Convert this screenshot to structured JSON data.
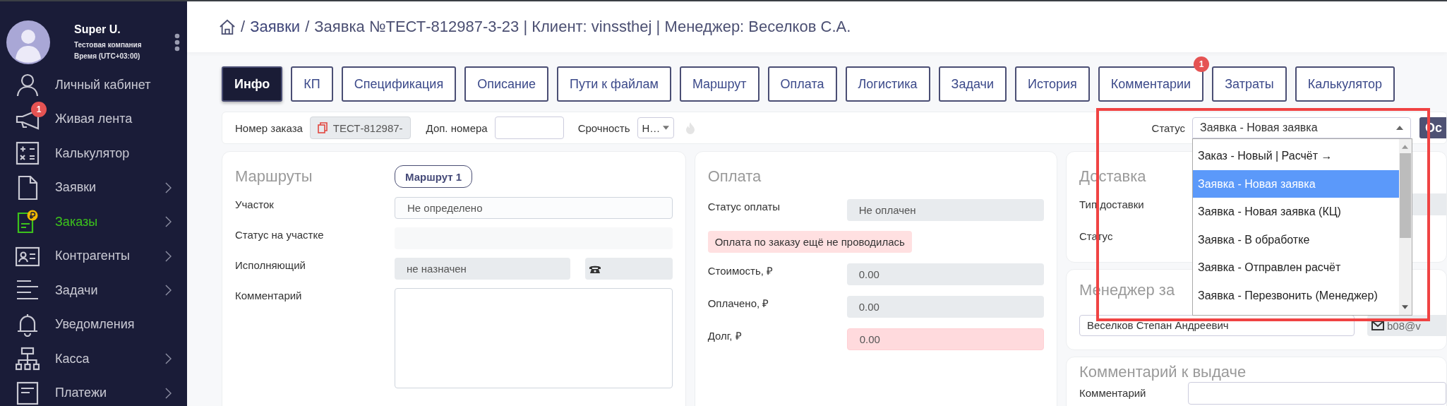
{
  "sidebar": {
    "user": {
      "name": "Super U.",
      "company": "Тестовая компания",
      "time": "Время (UTC+03:00)"
    },
    "items": [
      {
        "label": "Личный кабинет",
        "selected": false,
        "has_children": false
      },
      {
        "label": "Живая лента",
        "selected": false,
        "has_children": false,
        "badge": "1"
      },
      {
        "label": "Калькулятор",
        "selected": false,
        "has_children": false
      },
      {
        "label": "Заявки",
        "selected": false,
        "has_children": true
      },
      {
        "label": "Заказы",
        "selected": true,
        "has_children": true
      },
      {
        "label": "Контрагенты",
        "selected": false,
        "has_children": true
      },
      {
        "label": "Задачи",
        "selected": false,
        "has_children": true
      },
      {
        "label": "Уведомления",
        "selected": false,
        "has_children": false
      },
      {
        "label": "Касса",
        "selected": false,
        "has_children": true
      },
      {
        "label": "Платежи",
        "selected": false,
        "has_children": true
      }
    ]
  },
  "header": {
    "separator": "/",
    "breadcrumbs": [
      {
        "label": "Заявки",
        "kind": "link"
      },
      {
        "label": "Заявка №ТЕСТ-812987-3-23 | Клиент: vinssthej | Менеджер: Веселков С.А.",
        "kind": "text"
      }
    ]
  },
  "tabs": [
    {
      "label": "Инфо",
      "selected": true
    },
    {
      "label": "КП",
      "selected": false
    },
    {
      "label": "Спецификация",
      "selected": false
    },
    {
      "label": "Описание",
      "selected": false
    },
    {
      "label": "Пути к файлам",
      "selected": false
    },
    {
      "label": "Маршрут",
      "selected": false
    },
    {
      "label": "Оплата",
      "selected": false
    },
    {
      "label": "Логистика",
      "selected": false
    },
    {
      "label": "Задачи",
      "selected": false
    },
    {
      "label": "История",
      "selected": false
    },
    {
      "label": "Комментарии",
      "selected": false,
      "badge": "1"
    },
    {
      "label": "Затраты",
      "selected": false
    },
    {
      "label": "Калькулятор",
      "selected": false
    }
  ],
  "toolbar": {
    "order_number": {
      "label": "Номер заказа",
      "value": "ТЕСТ-812987-"
    },
    "extra_numbers": {
      "label": "Доп. номера"
    },
    "urgency": {
      "label": "Срочность",
      "value": "Н…"
    },
    "status": {
      "label": "Статус",
      "value": "Заявка - Новая заявка",
      "expanded": true,
      "options": [
        {
          "label": "Заказ - Новый | Расчёт →",
          "selected": false
        },
        {
          "label": "Заявка - Новая заявка",
          "selected": true
        },
        {
          "label": "Заявка - Новая заявка (КЦ)",
          "selected": false
        },
        {
          "label": "Заявка - В обработке",
          "selected": false
        },
        {
          "label": "Заявка - Отправлен расчёт",
          "selected": false
        },
        {
          "label": "Заявка - Перезвонить (Менеджер)",
          "selected": false
        }
      ]
    },
    "action_button": "Ос"
  },
  "routes": {
    "title": "Маршруты",
    "route_tabs": [
      {
        "label": "Маршрут 1",
        "selected": true
      }
    ],
    "fields": [
      {
        "label": "Участок",
        "value": "Не определено",
        "kind": "input"
      },
      {
        "label": "Статус на участке",
        "kind": "empty"
      },
      {
        "label": "Исполняющий",
        "value": "не назначен",
        "kind": "assignee"
      },
      {
        "label": "Комментарий",
        "kind": "textarea"
      }
    ]
  },
  "payment": {
    "title": "Оплата",
    "status": {
      "label": "Статус оплаты",
      "value": "Не оплачен"
    },
    "notice": "Оплата по заказу ещё не проводилась",
    "amounts": [
      {
        "label": "Стоимость, ₽",
        "value": "0.00",
        "alert": false
      },
      {
        "label": "Оплачено, ₽",
        "value": "0.00",
        "alert": false
      },
      {
        "label": "Долг, ₽",
        "value": "0.00",
        "alert": true
      }
    ]
  },
  "delivery": {
    "title": "Доставка",
    "fields": [
      {
        "label": "Тип доставки"
      },
      {
        "label": "Статус"
      }
    ]
  },
  "manager": {
    "title": "Менеджер за",
    "name": "Веселков Степан Андреевич",
    "email": "b08@v"
  },
  "issue_comment": {
    "title": "Комментарий к выдаче",
    "field_label": "Комментарий"
  }
}
